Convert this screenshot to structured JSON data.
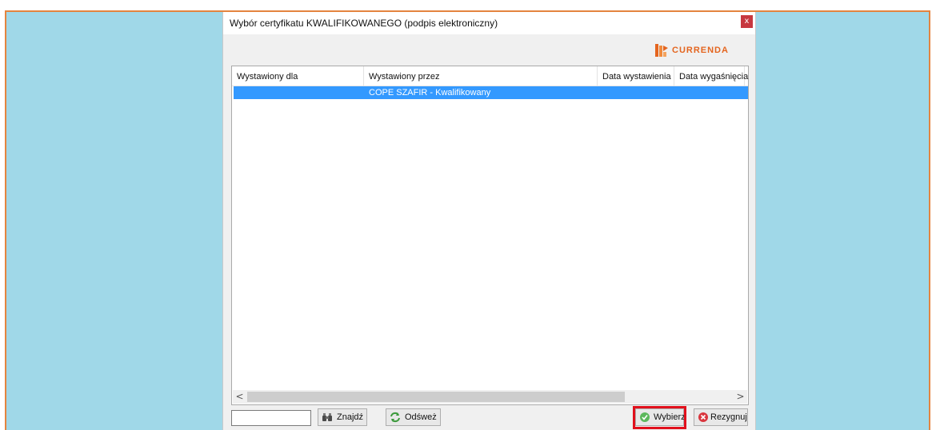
{
  "dialog": {
    "title": "Wybór certyfikatu KWALIFIKOWANEGO (podpis elektroniczny)",
    "close_label": "x"
  },
  "logo": {
    "text": "CURRENDA",
    "color": "#e4651f"
  },
  "table": {
    "columns": [
      "Wystawiony dla",
      "Wystawiony przez",
      "Data wystawienia",
      "Data wygaśnięcia"
    ],
    "rows": [
      {
        "issued_to": "",
        "issued_by": "COPE SZAFIR - Kwalifikowany",
        "issue_date": "",
        "expiry_date": "",
        "selected": true
      }
    ]
  },
  "scrollbar": {
    "left_arrow": "<",
    "right_arrow": ">"
  },
  "footer": {
    "search_value": "",
    "find_label": "Znajdź",
    "refresh_label": "Odśweż",
    "select_label": "Wybierz",
    "cancel_label": "Rezygnuj"
  },
  "colors": {
    "accent": "#e4843f",
    "selection": "#3399ff",
    "highlight": "#e1101c",
    "background": "#a0d8e8"
  }
}
